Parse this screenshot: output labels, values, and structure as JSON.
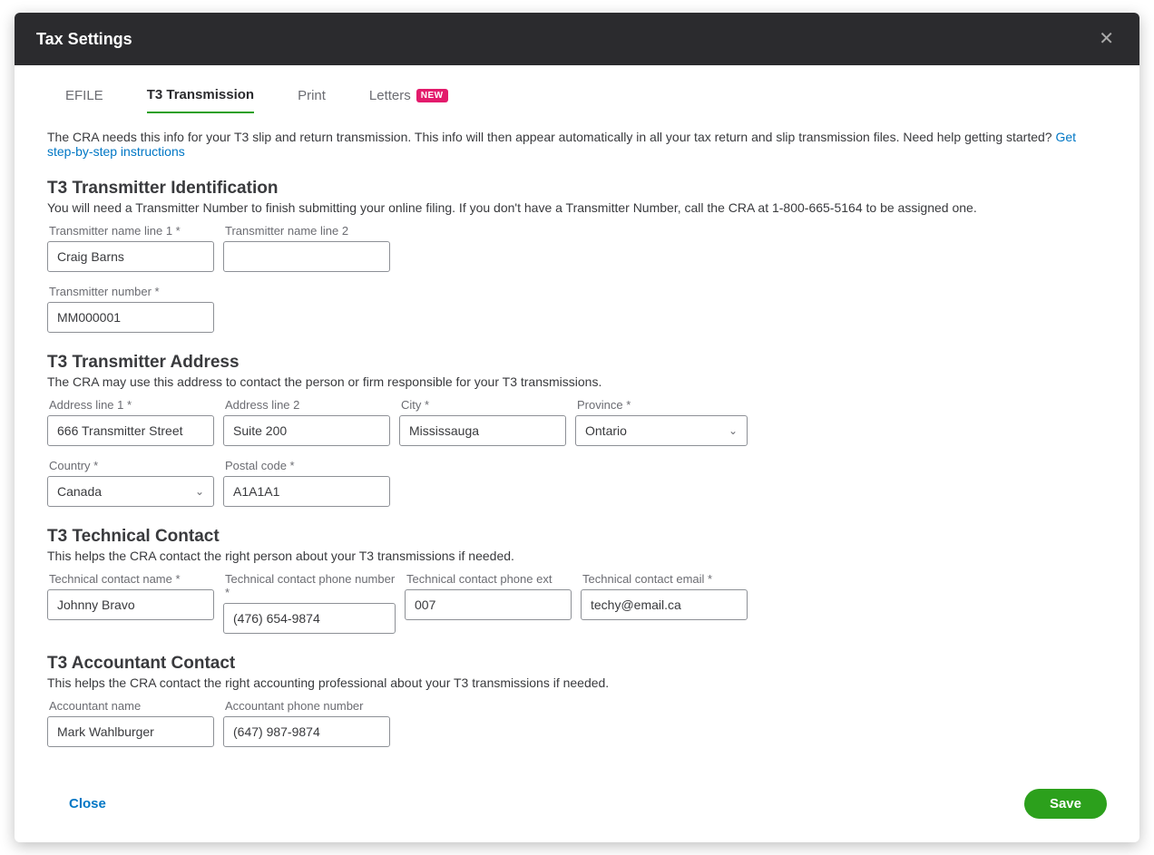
{
  "modal": {
    "title": "Tax Settings"
  },
  "tabs": {
    "efile": "EFILE",
    "t3": "T3 Transmission",
    "print": "Print",
    "letters": "Letters",
    "new_badge": "NEW"
  },
  "intro": {
    "text": "The CRA needs this info for your T3 slip and return transmission. This info will then appear automatically in all your tax return and slip transmission files. Need help getting started?",
    "link": "Get step-by-step instructions"
  },
  "sections": {
    "id": {
      "title": "T3 Transmitter Identification",
      "sub": "You will need a Transmitter Number to finish submitting your online filing. If you don't have a Transmitter Number, call the CRA at 1-800-665-5164 to be assigned one.",
      "name1_label": "Transmitter name line 1 *",
      "name1_value": "Craig Barns",
      "name2_label": "Transmitter name line 2",
      "name2_value": "",
      "num_label": "Transmitter number *",
      "num_value": "MM000001"
    },
    "addr": {
      "title": "T3 Transmitter Address",
      "sub": "The CRA may use this address to contact the person or firm responsible for your T3 transmissions.",
      "addr1_label": "Address line 1 *",
      "addr1_value": "666 Transmitter Street",
      "addr2_label": "Address line 2",
      "addr2_value": "Suite 200",
      "city_label": "City *",
      "city_value": "Mississauga",
      "prov_label": "Province *",
      "prov_value": "Ontario",
      "country_label": "Country *",
      "country_value": "Canada",
      "postal_label": "Postal code *",
      "postal_value": "A1A1A1"
    },
    "tech": {
      "title": "T3 Technical Contact",
      "sub": "This helps the CRA contact the right person about your T3 transmissions if needed.",
      "name_label": "Technical contact name *",
      "name_value": "Johnny Bravo",
      "phone_label": "Technical contact phone number *",
      "phone_value": "(476) 654-9874",
      "ext_label": "Technical contact phone ext",
      "ext_value": "007",
      "email_label": "Technical contact email *",
      "email_value": "techy@email.ca"
    },
    "acct": {
      "title": "T3 Accountant Contact",
      "sub": "This helps the CRA contact the right accounting professional about your T3 transmissions if needed.",
      "name_label": "Accountant name",
      "name_value": "Mark Wahlburger",
      "phone_label": "Accountant phone number",
      "phone_value": "(647) 987-9874"
    }
  },
  "footer": {
    "close": "Close",
    "save": "Save"
  }
}
